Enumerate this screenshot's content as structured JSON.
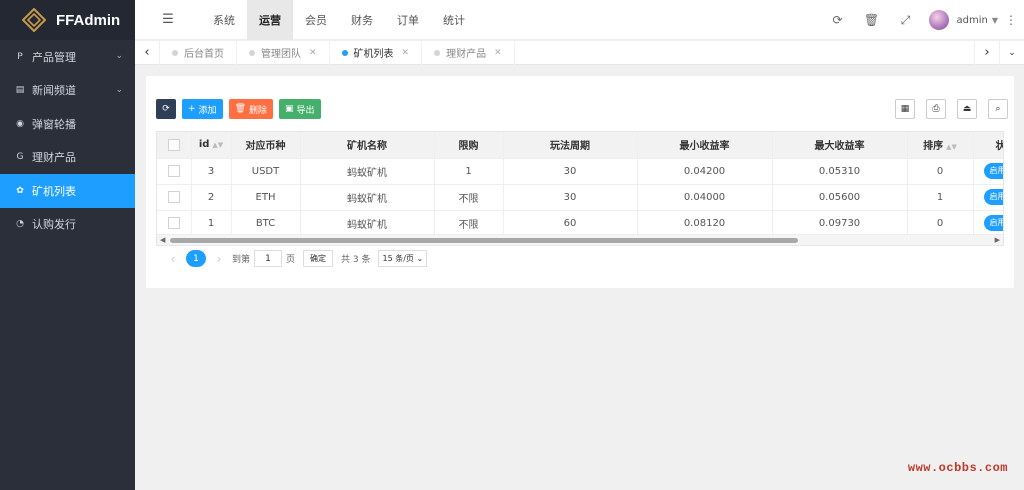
{
  "brand": {
    "name": "FFAdmin"
  },
  "sidebar": {
    "items": [
      {
        "label": "产品管理",
        "icon": "p-circle-icon",
        "glyph": "P",
        "has_submenu": true
      },
      {
        "label": "新闻频道",
        "icon": "newspaper-icon",
        "glyph": "▤",
        "has_submenu": true
      },
      {
        "label": "弹窗轮播",
        "icon": "compass-icon",
        "glyph": "◉",
        "has_submenu": false
      },
      {
        "label": "理财产品",
        "icon": "g-letter-icon",
        "glyph": "G",
        "has_submenu": false
      },
      {
        "label": "矿机列表",
        "icon": "cubes-icon",
        "glyph": "✿",
        "has_submenu": false,
        "active": true
      },
      {
        "label": "认购发行",
        "icon": "pie-chart-icon",
        "glyph": "◔",
        "has_submenu": false
      }
    ]
  },
  "topnav": {
    "tabs": [
      "系统",
      "运营",
      "会员",
      "财务",
      "订单",
      "统计"
    ],
    "active": "运营"
  },
  "user": {
    "name": "admin"
  },
  "page_tabs": [
    {
      "label": "后台首页",
      "closable": false,
      "active": false
    },
    {
      "label": "管理团队",
      "closable": true,
      "active": false
    },
    {
      "label": "矿机列表",
      "closable": true,
      "active": true
    },
    {
      "label": "理财产品",
      "closable": true,
      "active": false
    }
  ],
  "toolbar": {
    "add_label": "添加",
    "delete_label": "删除",
    "export_label": "导出"
  },
  "table": {
    "columns": [
      "id",
      "对应币种",
      "矿机名称",
      "限购",
      "玩法周期",
      "最小收益率",
      "最大收益率",
      "排序",
      "状"
    ],
    "rows": [
      {
        "id": "3",
        "coin": "USDT",
        "name": "蚂蚁矿机",
        "limit": "1",
        "cycle": "30",
        "min_rate": "0.04200",
        "max_rate": "0.05310",
        "sort": "0",
        "status": "启用"
      },
      {
        "id": "2",
        "coin": "ETH",
        "name": "蚂蚁矿机",
        "limit": "不限",
        "cycle": "30",
        "min_rate": "0.04000",
        "max_rate": "0.05600",
        "sort": "1",
        "status": "启用"
      },
      {
        "id": "1",
        "coin": "BTC",
        "name": "蚂蚁矿机",
        "limit": "不限",
        "cycle": "60",
        "min_rate": "0.08120",
        "max_rate": "0.09730",
        "sort": "0",
        "status": "启用"
      }
    ]
  },
  "pagination": {
    "current_page": "1",
    "goto_label": "到第",
    "goto_value": "1",
    "page_label": "页",
    "confirm_label": "确定",
    "total_label": "共 3 条",
    "page_size_label": "15 条/页"
  },
  "watermark": "www.ocbbs.com",
  "colors": {
    "accent": "#1e9fff",
    "sidebar": "#2a2f3a"
  }
}
